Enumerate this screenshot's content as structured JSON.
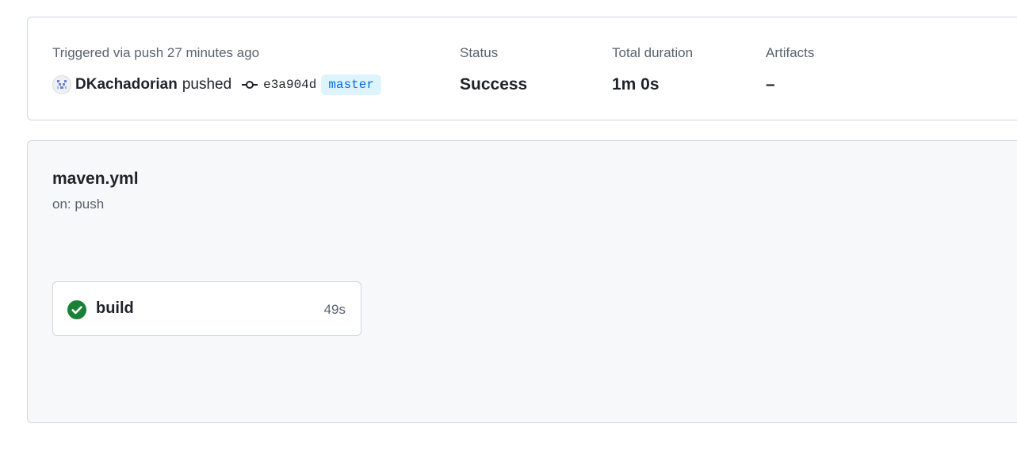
{
  "summary": {
    "trigger_text": "Triggered via push 27 minutes ago",
    "actor": "DKachadorian",
    "action": "pushed",
    "commit_sha": "e3a904d",
    "branch": "master",
    "status_label": "Status",
    "status_value": "Success",
    "duration_label": "Total duration",
    "duration_value": "1m 0s",
    "artifacts_label": "Artifacts",
    "artifacts_value": "–"
  },
  "workflow": {
    "file_name": "maven.yml",
    "trigger": "on: push",
    "jobs": [
      {
        "name": "build",
        "duration": "49s",
        "status": "success",
        "status_icon": "check-circle-fill-icon"
      }
    ]
  },
  "colors": {
    "success": "#1a7f37",
    "branch_text": "#0969da",
    "branch_bg": "#ddf4ff",
    "muted_text": "#59636e",
    "border": "#d0d7de",
    "panel_bg": "#f6f8fa"
  },
  "icons": {
    "avatar": "identicon-avatar",
    "commit": "git-commit-icon",
    "job_status": "check-circle-fill-icon"
  }
}
